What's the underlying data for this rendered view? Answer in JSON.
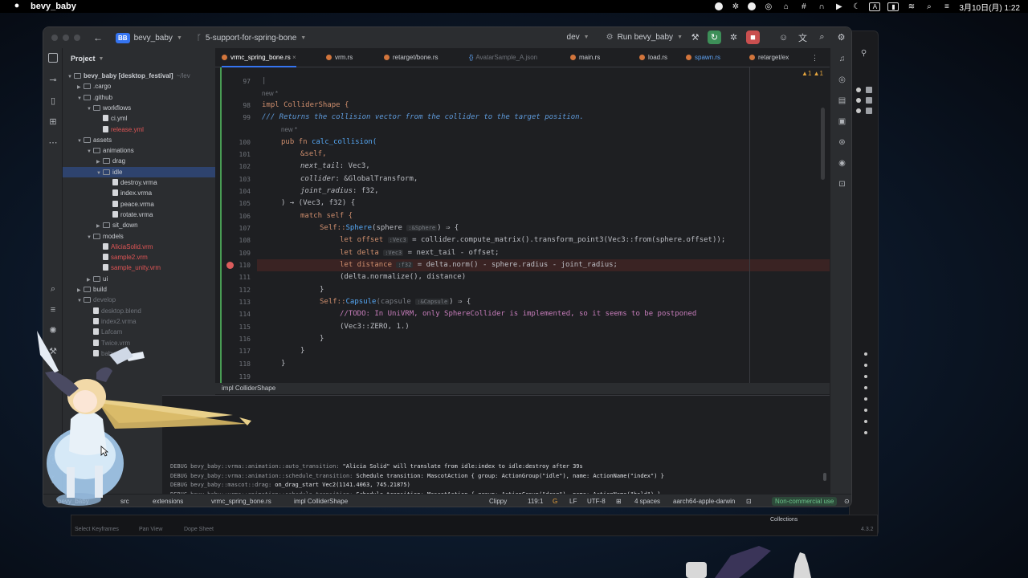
{
  "menubar": {
    "app_name": "bevy_baby",
    "datetime": "3月10日(月)  1:22",
    "input_mode": "A"
  },
  "titlebar": {
    "project_badge": "BB",
    "project_name": "bevy_baby",
    "branch": "5-support-for-spring-bone",
    "profile": "dev",
    "run_config": "Run bevy_baby"
  },
  "project_panel": {
    "title": "Project",
    "items": [
      {
        "label": "bevy_baby [desktop_festival]",
        "extra": "~/lev"
      },
      {
        "label": ".cargo"
      },
      {
        "label": ".github"
      },
      {
        "label": "workflows"
      },
      {
        "label": "ci.yml"
      },
      {
        "label": "release.yml"
      },
      {
        "label": "assets"
      },
      {
        "label": "animations"
      },
      {
        "label": "drag"
      },
      {
        "label": "idle"
      },
      {
        "label": "destroy.vrma"
      },
      {
        "label": "index.vrma"
      },
      {
        "label": "peace.vrma"
      },
      {
        "label": "rotate.vrma"
      },
      {
        "label": "sit_down"
      },
      {
        "label": "models"
      },
      {
        "label": "AliciaSolid.vrm"
      },
      {
        "label": "sample2.vrm"
      },
      {
        "label": "sample_unity.vrm"
      },
      {
        "label": "ui"
      },
      {
        "label": "build"
      },
      {
        "label": "develop"
      },
      {
        "label": "desktop.blend"
      },
      {
        "label": "index2.vrma"
      },
      {
        "label": "Lafcam"
      },
      {
        "label": "Twice.vrm"
      },
      {
        "label": "baby"
      }
    ]
  },
  "tabs": [
    {
      "label": "vrmc_spring_bone.rs"
    },
    {
      "label": "vrm.rs"
    },
    {
      "label": "retarget/bone.rs"
    },
    {
      "label": "AvatarSample_A.json"
    },
    {
      "label": "main.rs"
    },
    {
      "label": "load.rs"
    },
    {
      "label": "spawn.rs"
    },
    {
      "label": "retarget/ex"
    }
  ],
  "editor": {
    "warnings": "▲1  ▲1",
    "hint_new": "new *",
    "line_numbers": [
      "97",
      "98",
      "99",
      "100",
      "101",
      "102",
      "103",
      "104",
      "105",
      "106",
      "107",
      "108",
      "109",
      "110",
      "111",
      "112",
      "113",
      "114",
      "115",
      "116",
      "117",
      "118",
      "119"
    ],
    "lines": {
      "l98": "impl ColliderShape {",
      "l99": "/// Returns the collision vector from the collider to the target position.",
      "l100_k": "pub fn ",
      "l100_f": "calc_collision(",
      "l101": "&self,",
      "l102_p": "next_tail",
      "l102_t": ": Vec3,",
      "l103_p": "collider",
      "l103_t": ": &GlobalTransform,",
      "l104_p": "joint_radius",
      "l104_t": ": f32,",
      "l105": ") → (Vec3, f32) {",
      "l106": "match self {",
      "l107_a": "Self::",
      "l107_b": "Sphere",
      "l107_c": "(sphere ",
      "l107_h": ":&Sphere",
      "l107_d": ") ⇒ {",
      "l108_a": "let offset ",
      "l108_h": ":Vec3",
      "l108_b": " = collider.compute_matrix().transform_point3(Vec3::from(sphere.offset));",
      "l109_a": "let delta ",
      "l109_h": ":Vec3",
      "l109_b": " = next_tail - offset;",
      "l110_a": "let distance ",
      "l110_h": ":f32",
      "l110_b": " = delta.norm() - sphere.radius - joint_radius;",
      "l111": "(delta.normalize(), distance)",
      "l112": "}",
      "l113_a": "Self::",
      "l113_b": "Capsule",
      "l113_c": "(capsule ",
      "l113_h": ":&Capsule",
      "l113_d": ") ⇒ {",
      "l114": "//TODO: In UniVRM, only SphereCollider is implemented, so it seems to be postponed",
      "l115": "(Vec3::ZERO, 1.)",
      "l116": "}",
      "l117": "}",
      "l118": "}"
    },
    "breadcrumb": "impl ColliderShape"
  },
  "run_log": [
    {
      "level": "DEBUG",
      "module": "bevy_baby::vrma::animation::auto_transition:",
      "message": "\"Alicia Solid\" will translate from idle:index to idle:destroy after 39s"
    },
    {
      "level": "DEBUG",
      "module": "bevy_baby::vrma::animation::schedule_transition:",
      "message": "Schedule transition: MascotAction { group: ActionGroup(\"idle\"), name: ActionName(\"index\") }"
    },
    {
      "level": "DEBUG",
      "module": "bevy_baby::mascot::drag:",
      "message": "on_drag_start Vec2(1141.4063, 745.21875)"
    },
    {
      "level": "DEBUG",
      "module": "bevy_baby::vrma::animation::schedule_transition:",
      "message": "Schedule transition: MascotAction { group: ActionGroup(\"drag\"), name: ActionName(\"hold\") }"
    }
  ],
  "statusbar": {
    "crumbs": [
      "bevy_baby",
      "src",
      "extensions",
      "vrmc_spring_bone.rs",
      "impl ColliderShape"
    ],
    "clippy": "Clippy",
    "position": "119:1",
    "line_ending": "LF",
    "encoding": "UTF-8",
    "indent": "4 spaces",
    "target": "aarch64-apple-darwin",
    "license": "Non-commercial use"
  },
  "background_window": {
    "bottom_items": [
      "Select Keyframes",
      "Pan View",
      "Dope Sheet"
    ],
    "collections": "Collections",
    "version": "4.3.2"
  },
  "colors": {
    "accent": "#3574f0",
    "green_gutter": "#499c54",
    "breakpoint": "#db5c5c",
    "error_file": "#e05555"
  }
}
